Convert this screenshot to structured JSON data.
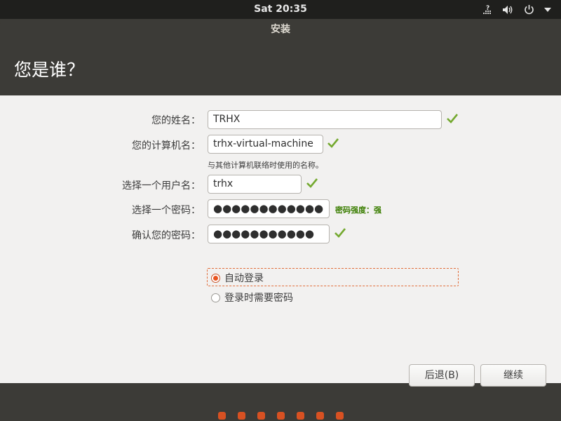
{
  "panel": {
    "clock": "Sat 20:35",
    "icons": [
      "network-icon",
      "volume-icon",
      "power-icon",
      "menu-arrow-icon"
    ]
  },
  "window": {
    "title": "安装",
    "heading": "您是谁？"
  },
  "form": {
    "name_label": "您的姓名：",
    "name_value": "TRHX",
    "computer_label": "您的计算机名：",
    "computer_value": "trhx-virtual-machine",
    "computer_hint": "与其他计算机联络时使用的名称。",
    "username_label": "选择一个用户名：",
    "username_value": "trhx",
    "password_label": "选择一个密码：",
    "password_value": "●●●●●●●●●●●●",
    "password_strength": "密码强度：强",
    "confirm_label": "确认您的密码：",
    "confirm_value": "●●●●●●●●●●●",
    "auto_login_label": "自动登录",
    "require_password_label": "登录时需要密码",
    "auto_login_selected": true,
    "check_color": "#74a92f"
  },
  "buttons": {
    "back": "后退(B)",
    "continue": "继续"
  },
  "progress": {
    "total_steps": 7,
    "accent": "#e95420"
  }
}
